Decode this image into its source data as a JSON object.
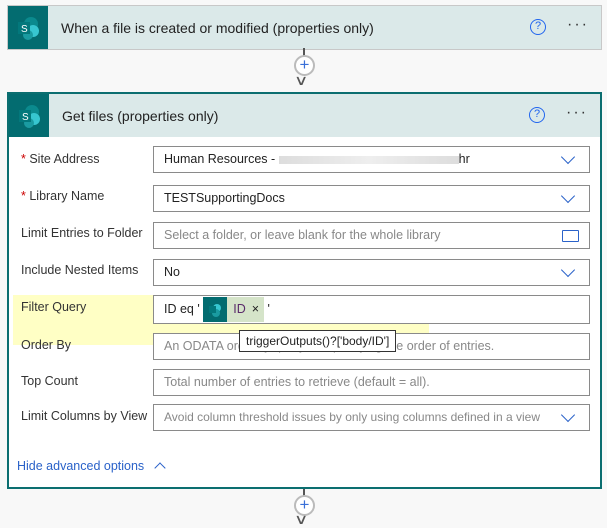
{
  "trigger": {
    "title": "When a file is created or modified (properties only)",
    "help_icon": "question-circle-icon",
    "more_icon": "ellipsis-icon"
  },
  "action": {
    "title": "Get files (properties only)",
    "accent": "#036c70",
    "fields": [
      {
        "label": "Site Address",
        "required": true,
        "value": "Human Resources - ",
        "value_suffix": "hr",
        "type": "dropdown"
      },
      {
        "label": "Library Name",
        "required": true,
        "value": "TESTSupportingDocs",
        "type": "dropdown"
      },
      {
        "label": "Limit Entries to Folder",
        "placeholder": "Select a folder, or leave blank for the whole library",
        "type": "folder"
      },
      {
        "label": "Include Nested Items",
        "value": "No",
        "type": "dropdown"
      },
      {
        "label": "Filter Query",
        "prefix": "ID eq '",
        "token": "ID",
        "suffix": "'"
      },
      {
        "label": "Order By",
        "placeholder": "An ODATA orderBy query for specifying the order of entries."
      },
      {
        "label": "Top Count",
        "placeholder": "Total number of entries to retrieve (default = all)."
      },
      {
        "label": "Limit Columns by View",
        "placeholder": "Avoid column threshold issues by only using columns defined in a view",
        "type": "dropdown"
      }
    ],
    "tooltip": "triggerOutputs()?['body/ID']",
    "hide_advanced": "Hide advanced options"
  }
}
